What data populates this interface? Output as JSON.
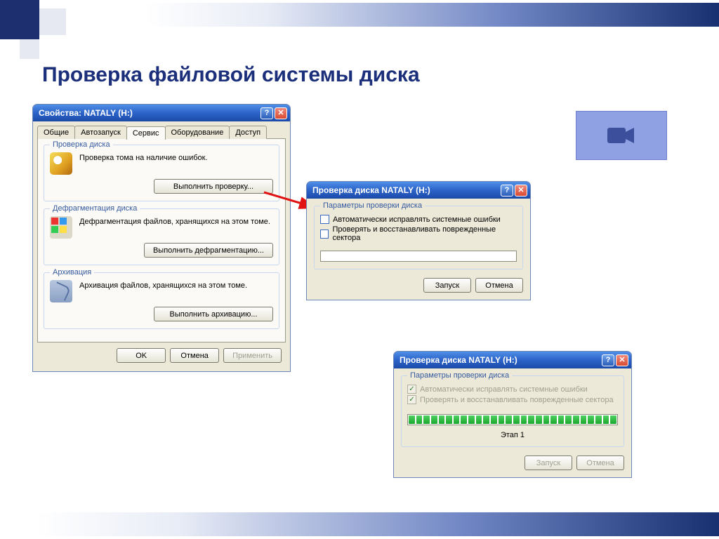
{
  "page": {
    "title": "Проверка файловой системы диска"
  },
  "props": {
    "title": "Свойства: NATALY (H:)",
    "tabs": [
      "Общие",
      "Автозапуск",
      "Сервис",
      "Оборудование",
      "Доступ"
    ],
    "activeTab": 2,
    "groups": {
      "check": {
        "legend": "Проверка диска",
        "text": "Проверка тома на наличие ошибок.",
        "button": "Выполнить проверку..."
      },
      "defrag": {
        "legend": "Дефрагментация диска",
        "text": "Дефрагментация файлов, хранящихся на этом томе.",
        "button": "Выполнить дефрагментацию..."
      },
      "backup": {
        "legend": "Архивация",
        "text": "Архивация файлов, хранящихся на этом томе.",
        "button": "Выполнить архивацию..."
      }
    },
    "buttons": {
      "ok": "OK",
      "cancel": "Отмена",
      "apply": "Применить"
    }
  },
  "checkDlg": {
    "title": "Проверка диска NATALY (H:)",
    "legend": "Параметры проверки диска",
    "opt1": "Автоматически исправлять системные ошибки",
    "opt2": "Проверять и восстанавливать поврежденные сектора",
    "buttons": {
      "start": "Запуск",
      "cancel": "Отмена"
    }
  },
  "runDlg": {
    "title": "Проверка диска NATALY (H:)",
    "legend": "Параметры проверки диска",
    "opt1": "Автоматически исправлять системные ошибки",
    "opt2": "Проверять и восстанавливать поврежденные сектора",
    "stage": "Этап 1",
    "buttons": {
      "start": "Запуск",
      "cancel": "Отмена"
    }
  },
  "titleButtons": {
    "help": "?",
    "close": "✕"
  },
  "progress": {
    "segments": 28
  }
}
